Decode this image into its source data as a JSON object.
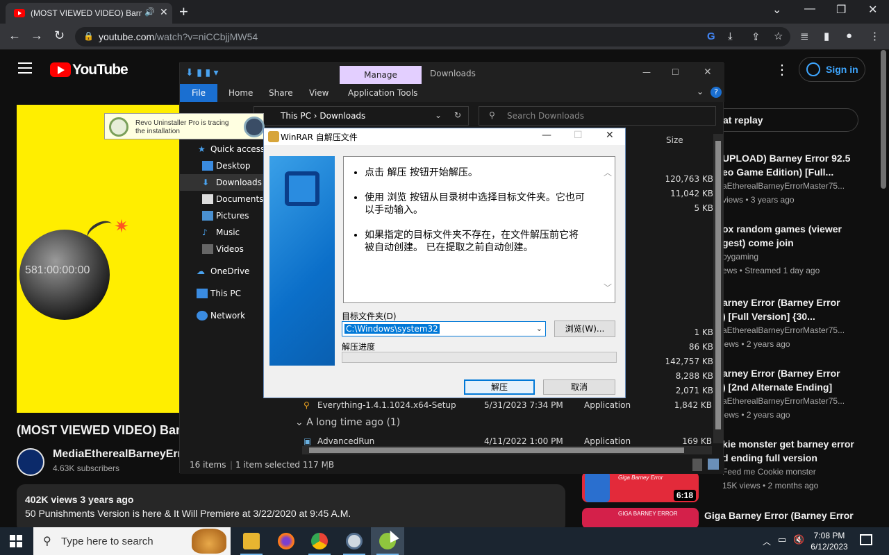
{
  "browser": {
    "tab_title": "(MOST VIEWED VIDEO) Barney",
    "url_domain": "youtube.com",
    "url_path": "/watch?v=niCCbjjMW54",
    "minimize": "—",
    "restore": "❐",
    "close": "✕",
    "new_tab": "+",
    "tab_close": "✕",
    "back": "←",
    "forward": "→",
    "reload": "↻",
    "lock": "🔒",
    "google": "G",
    "download": "⤓",
    "share": "⇪",
    "star": "☆",
    "playlist": "≣",
    "sidepanel": "▮",
    "profile": "●",
    "menu": "⋮"
  },
  "youtube": {
    "logo_text": "YouTube",
    "sign_in": "Sign in",
    "more": "⋮",
    "video_title": "(MOST VIEWED VIDEO) Bar",
    "timer_text": "581:00:00:00",
    "channel_name": "MediaEtherealBarneyErro",
    "subscribers": "4.63K subscribers",
    "views_age": "402K views  3 years ago",
    "description": "50 Punishments Version is here & It Will Premiere at 3/22/2020 at 9:45 A.M.",
    "chip": "at replay",
    "recommendations": [
      {
        "t1": "UPLOAD) Barney Error 92.5",
        "t2": "eo Game Edition) [Full...",
        "m1": "aEtherealBarneyErrorMaster75...",
        "m2": "views • 3 years ago"
      },
      {
        "t1": "ox random games (viewer",
        "t2": "gest) come join",
        "m1": "oygaming",
        "m2": "ews • Streamed 1 day ago"
      },
      {
        "t1": "arney Error (Barney Error",
        "t2": ") [Full Version] {30...",
        "m1": "aEtherealBarneyErrorMaster75...",
        "m2": "iews • 2 years ago"
      },
      {
        "t1": "arney Error (Barney Error",
        "t2": ") [2nd Alternate Ending]",
        "m1": "aEtherealBarneyErrorMaster75...",
        "m2": "iews • 2 years ago"
      },
      {
        "t1": "kie monster get barney error",
        "t2": "d ending full version",
        "m1": "Feed me Cookie monster",
        "m2": "15K views • 2 months ago"
      }
    ],
    "thumb1_label": "Giga Barney Error",
    "thumb1_duration": "6:18",
    "thumb2_label": "GIGA BARNEY ERROR",
    "last_rec_title": "Giga Barney Error (Barney Error"
  },
  "explorer": {
    "manage_tab": "Manage",
    "title": "Downloads",
    "ribbon": [
      "File",
      "Home",
      "Share",
      "View",
      "Application Tools"
    ],
    "help": "?",
    "path_this_pc": "This PC",
    "path_downloads": "Downloads",
    "search_placeholder": "Search Downloads",
    "nav": [
      "Quick access",
      "Desktop",
      "Downloads",
      "Documents",
      "Pictures",
      "Music",
      "Videos",
      "OneDrive",
      "This PC",
      "Network"
    ],
    "size_header": "Size",
    "sizes_top": [
      "120,763 KB",
      "11,042 KB",
      "5 KB"
    ],
    "sizes_mid": [
      "1 KB",
      "86 KB",
      "142,757 KB",
      "8,288 KB",
      "2,071 KB"
    ],
    "file_everything": {
      "name": "Everything-1.4.1.1024.x64-Setup",
      "date": "5/31/2023 7:34 PM",
      "type": "Application",
      "size": "1,842 KB"
    },
    "group_label": "A long time ago (1)",
    "file_advancedrun": {
      "name": "AdvancedRun",
      "date": "4/11/2022 1:00 PM",
      "type": "Application",
      "size": "169 KB"
    },
    "status_items": "16 items",
    "status_selected": "1 item selected  117 MB"
  },
  "revo": {
    "line1": "Revo Uninstaller Pro is tracing",
    "line2": "the installation"
  },
  "winrar": {
    "title": "WinRAR 自解压文件",
    "bullets": [
      "点击 解压 按钮开始解压。",
      "使用 浏览 按钮从目录树中选择目标文件夹。它也可以手动输入。",
      "如果指定的目标文件夹不存在，在文件解压前它将被自动创建。 已在提取之前自动创建。"
    ],
    "dest_label": "目标文件夹(D)",
    "dest_value": "C:\\Windows\\system32",
    "browse": "浏览(W)...",
    "progress_label": "解压进度",
    "progress": 0,
    "ok": "解压",
    "cancel": "取消"
  },
  "taskbar": {
    "search_placeholder": "Type here to search",
    "time": "7:08 PM",
    "date": "6/12/2023"
  }
}
